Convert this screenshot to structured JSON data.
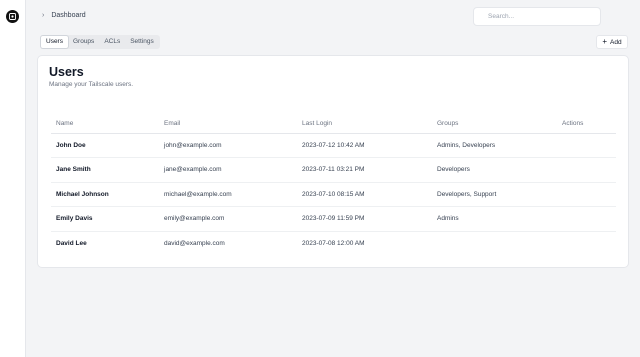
{
  "sidebar": {
    "logo_icon": "tailscale-logo-icon"
  },
  "header": {
    "breadcrumb_label": "Dashboard",
    "search_placeholder": "Search..."
  },
  "tabs": [
    {
      "label": "Users",
      "active": true
    },
    {
      "label": "Groups",
      "active": false
    },
    {
      "label": "ACLs",
      "active": false
    },
    {
      "label": "Settings",
      "active": false
    }
  ],
  "add_button": {
    "icon": "+",
    "label": "Add"
  },
  "users_panel": {
    "title": "Users",
    "subtitle": "Manage your Tailscale users.",
    "columns": [
      "Name",
      "Email",
      "Last Login",
      "Groups",
      "Actions"
    ],
    "rows": [
      {
        "name": "John Doe",
        "email": "john@example.com",
        "last_login": "2023-07-12 10:42 AM",
        "groups": "Admins, Developers",
        "actions": ""
      },
      {
        "name": "Jane Smith",
        "email": "jane@example.com",
        "last_login": "2023-07-11 03:21 PM",
        "groups": "Developers",
        "actions": ""
      },
      {
        "name": "Michael Johnson",
        "email": "michael@example.com",
        "last_login": "2023-07-10 08:15 AM",
        "groups": "Developers, Support",
        "actions": ""
      },
      {
        "name": "Emily Davis",
        "email": "emily@example.com",
        "last_login": "2023-07-09 11:59 PM",
        "groups": "Admins",
        "actions": ""
      },
      {
        "name": "David Lee",
        "email": "david@example.com",
        "last_login": "2023-07-08 12:00 AM",
        "groups": "",
        "actions": ""
      }
    ]
  }
}
